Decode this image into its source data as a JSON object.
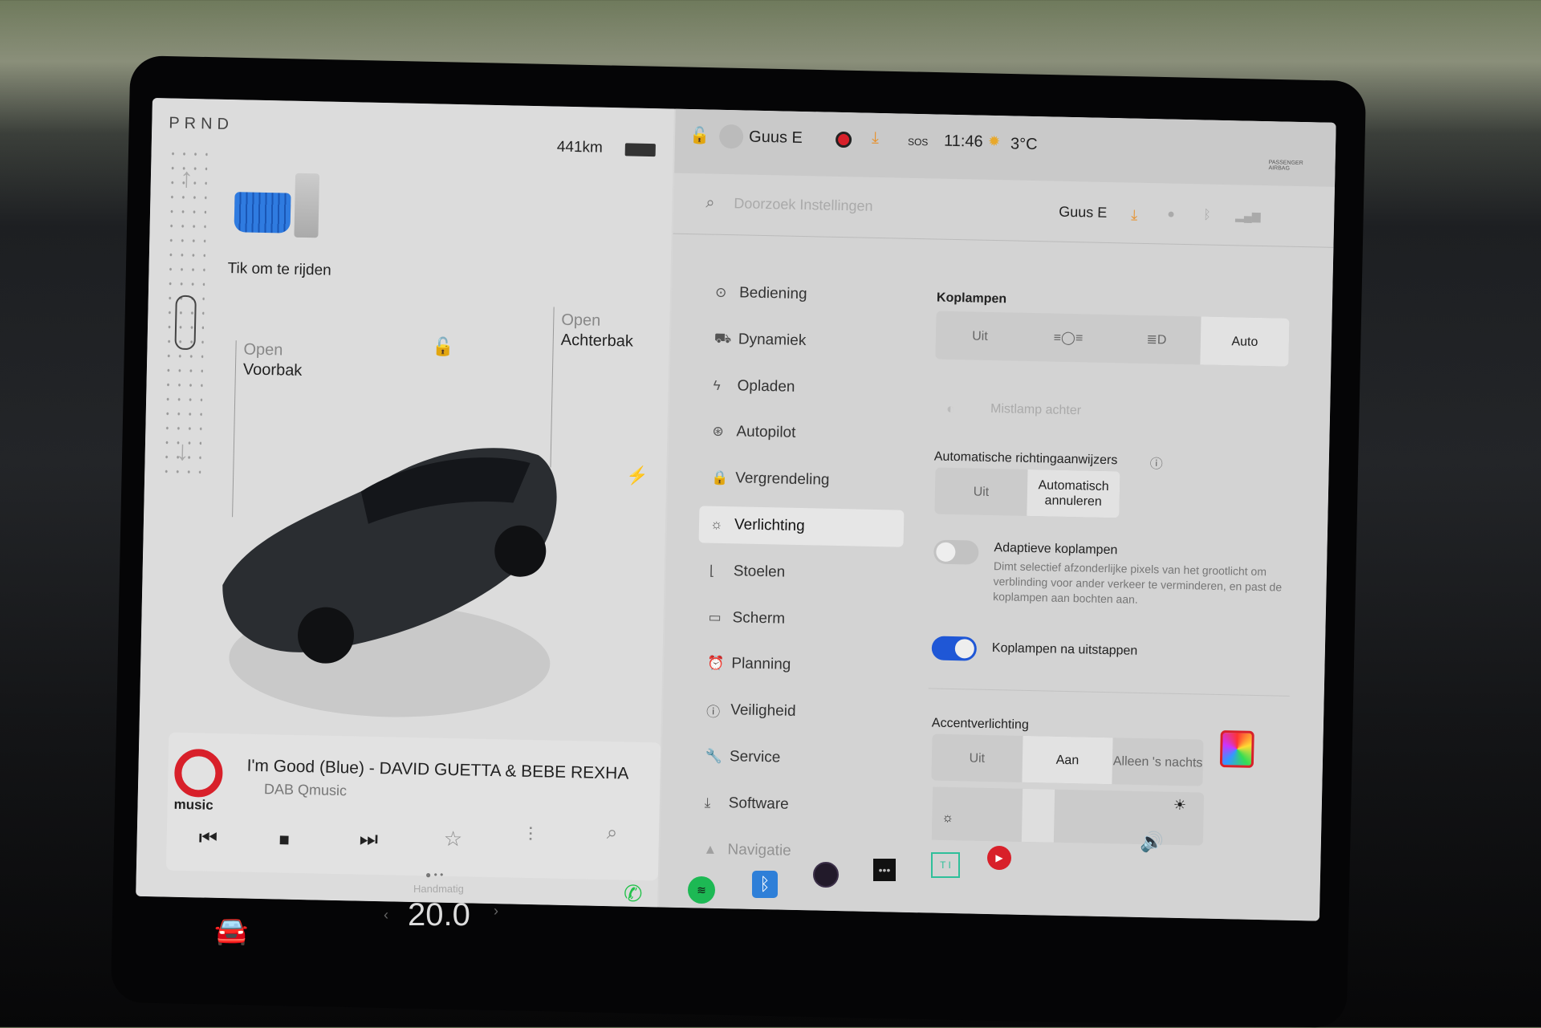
{
  "drive": {
    "gears": "PRND",
    "range": "441km",
    "tap_to_drive": "Tik om te rijden",
    "frunk_open": "Open",
    "frunk_label": "Voorbak",
    "trunk_open": "Open",
    "trunk_label": "Achterbak"
  },
  "statusbar": {
    "profile": "Guus E",
    "time": "11:46",
    "temperature": "3°C",
    "sos": "SOS",
    "airbag": "PASSENGER AIRBAG"
  },
  "settings": {
    "search_placeholder": "Doorzoek Instellingen",
    "profile": "Guus E",
    "menu": [
      {
        "label": "Bediening",
        "icon": "toggle-icon"
      },
      {
        "label": "Dynamiek",
        "icon": "car-icon"
      },
      {
        "label": "Opladen",
        "icon": "bolt-icon"
      },
      {
        "label": "Autopilot",
        "icon": "steering-wheel-icon"
      },
      {
        "label": "Vergrendeling",
        "icon": "lock-icon"
      },
      {
        "label": "Verlichting",
        "icon": "light-icon",
        "selected": true
      },
      {
        "label": "Stoelen",
        "icon": "seat-icon"
      },
      {
        "label": "Scherm",
        "icon": "screen-icon"
      },
      {
        "label": "Planning",
        "icon": "alarm-icon"
      },
      {
        "label": "Veiligheid",
        "icon": "alert-icon"
      },
      {
        "label": "Service",
        "icon": "wrench-icon"
      },
      {
        "label": "Software",
        "icon": "download-icon"
      },
      {
        "label": "Navigatie",
        "icon": "navigation-icon"
      }
    ],
    "headlights": {
      "title": "Koplampen",
      "options": [
        "Uit",
        "parking-lights",
        "low-beam",
        "Auto"
      ],
      "selected": "Auto"
    },
    "rear_fog": "Mistlamp achter",
    "auto_turn": {
      "title": "Automatische richtingaanwijzers",
      "options": [
        "Uit",
        "Automatisch annuleren"
      ],
      "selected": "Automatisch annuleren"
    },
    "adaptive": {
      "title": "Adaptieve koplampen",
      "desc": "Dimt selectief afzonderlijke pixels van het grootlicht om verblinding voor ander verkeer te verminderen, en past de koplampen aan bochten aan.",
      "on": false
    },
    "after_exit": {
      "title": "Koplampen na uitstappen",
      "on": true
    },
    "accent": {
      "title": "Accentverlichting",
      "options": [
        "Uit",
        "Aan",
        "Alleen 's nachts"
      ],
      "selected": "Aan",
      "brightness": 0.45
    }
  },
  "media": {
    "logo": "Q music",
    "title": "I'm Good (Blue) - DAVID GUETTA & BEBE REXHA",
    "source": "DAB Qmusic"
  },
  "climate": {
    "mode": "Handmatig",
    "temp": "20.0"
  },
  "colors": {
    "accent": "#1f57d6",
    "orange": "#e8902a",
    "record": "#d8202a",
    "spotify": "#1db954",
    "phone": "#22c24a",
    "bluetooth": "#2e7fd8"
  }
}
